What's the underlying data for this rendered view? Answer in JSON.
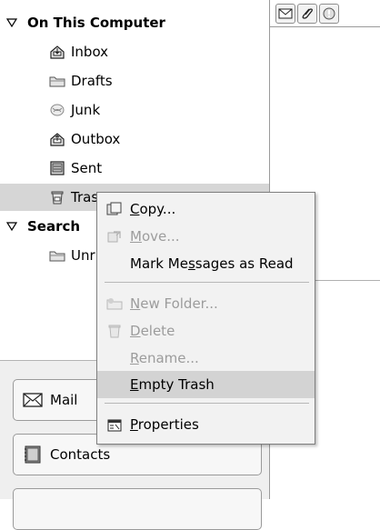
{
  "folder_tree": {
    "groups": [
      {
        "label": "On This Computer",
        "expanded": true
      },
      {
        "label": "Search",
        "expanded": true
      }
    ],
    "folders": [
      {
        "label": "Inbox",
        "icon": "inbox-icon"
      },
      {
        "label": "Drafts",
        "icon": "drafts-folder-icon"
      },
      {
        "label": "Junk",
        "icon": "junk-icon"
      },
      {
        "label": "Outbox",
        "icon": "outbox-icon"
      },
      {
        "label": "Sent",
        "icon": "sent-icon"
      },
      {
        "label": "Tras",
        "icon": "trash-icon",
        "selected": true
      },
      {
        "label": "Unr",
        "icon": "search-folder-icon"
      }
    ]
  },
  "message_list": {
    "column_icons": [
      "envelope-status-icon",
      "attachment-icon",
      "priority-icon"
    ]
  },
  "switcher": {
    "mail_label": "Mail",
    "contacts_label": "Contacts"
  },
  "context_menu": {
    "items": [
      {
        "label": "Copy...",
        "mnemonic": "C",
        "enabled": true,
        "icon": "copy-icon"
      },
      {
        "label": "Move...",
        "mnemonic": "M",
        "enabled": false,
        "icon": "move-icon"
      },
      {
        "label": "Mark Messages as Read",
        "mnemonic": "s",
        "enabled": true,
        "icon": ""
      },
      {
        "label": "New Folder...",
        "mnemonic": "N",
        "enabled": false,
        "icon": "new-folder-icon"
      },
      {
        "label": "Delete",
        "mnemonic": "D",
        "enabled": false,
        "icon": "delete-icon"
      },
      {
        "label": "Rename...",
        "mnemonic": "R",
        "enabled": false,
        "icon": ""
      },
      {
        "label": "Empty Trash",
        "mnemonic": "E",
        "enabled": true,
        "highlighted": true,
        "icon": ""
      },
      {
        "label": "Properties",
        "mnemonic": "P",
        "enabled": true,
        "icon": "properties-icon"
      }
    ]
  }
}
